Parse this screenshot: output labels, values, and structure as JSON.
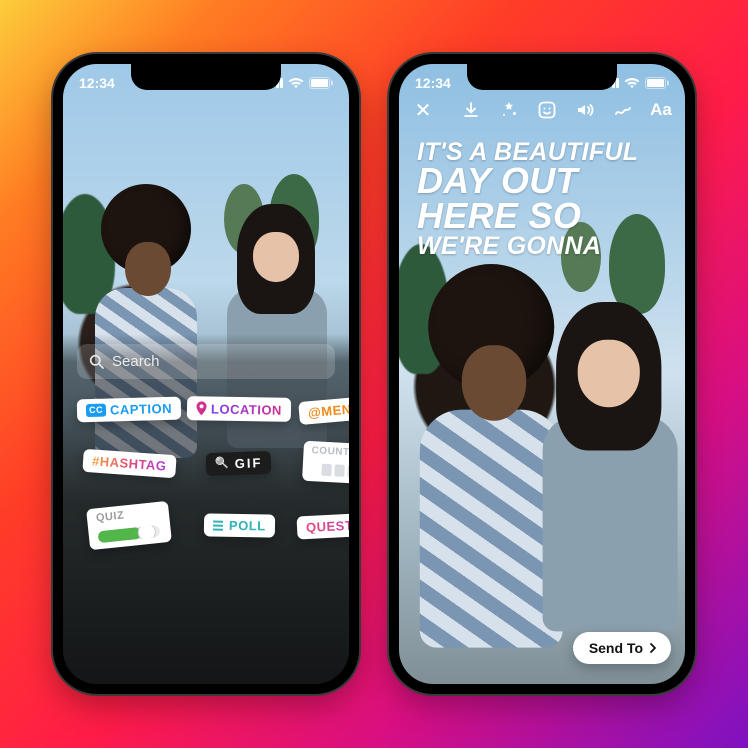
{
  "status": {
    "time": "12:34"
  },
  "phone1": {
    "search": {
      "placeholder": "Search"
    },
    "stickers": {
      "caption": {
        "label": "CAPTION",
        "badge": "CC"
      },
      "location": {
        "label": "LOCATION"
      },
      "mention": {
        "label": "@MENTION"
      },
      "hashtag": {
        "label": "#HASHTAG"
      },
      "gif": {
        "label": "GIF",
        "prefix": "🔍"
      },
      "countdown": {
        "label": "COUNTDOWN"
      },
      "quiz": {
        "label": "QUIZ"
      },
      "poll": {
        "label": "POLL"
      },
      "questions": {
        "label": "QUESTIONS"
      }
    }
  },
  "phone2": {
    "caption": {
      "line1": "IT'S A BEAUTIFUL",
      "line2": "DAY OUT",
      "line3": "HERE SO",
      "line4": "WE'RE GONNA"
    },
    "toolbar": {
      "close": "✕",
      "text_tool": "Aa"
    },
    "send_to": {
      "label": "Send To"
    }
  }
}
